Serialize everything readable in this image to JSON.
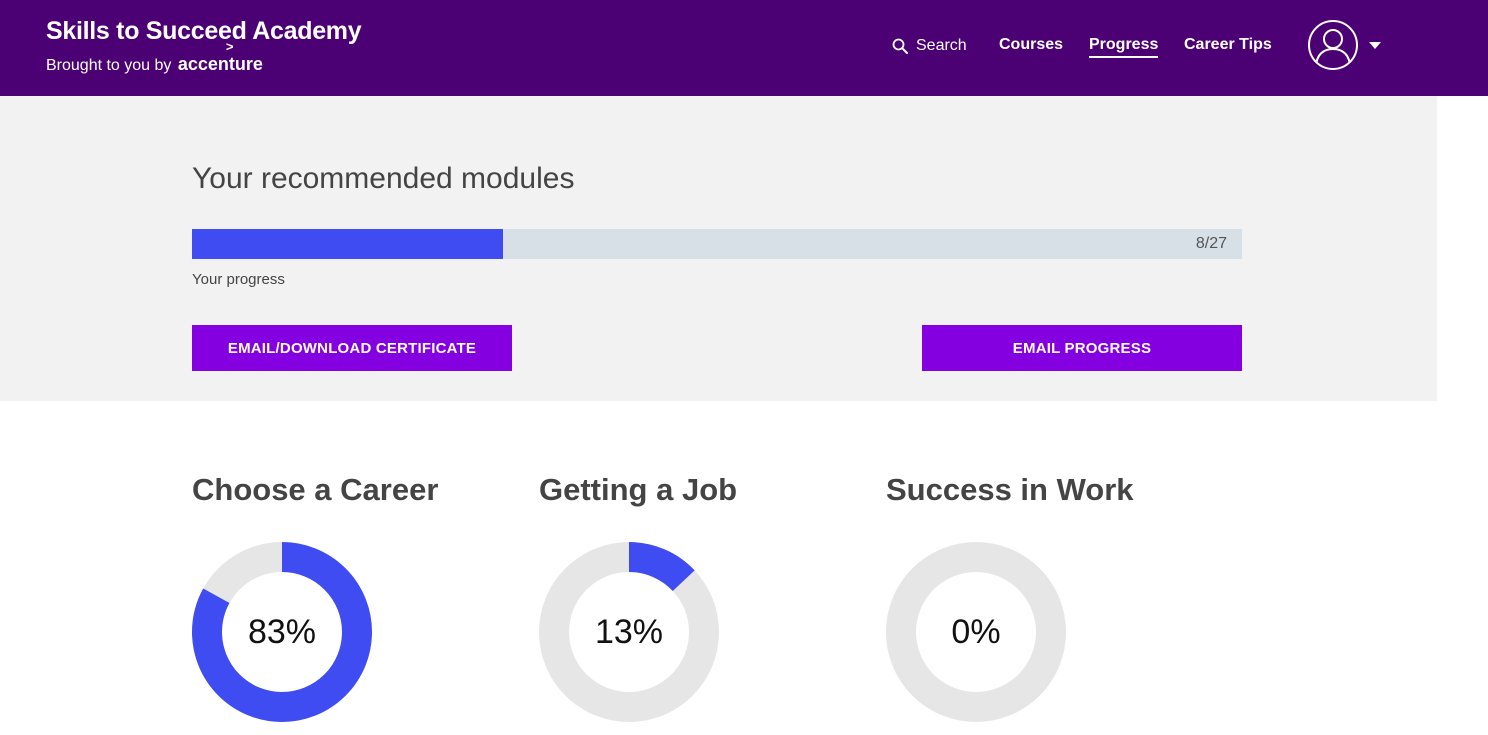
{
  "header": {
    "title": "Skills to Succeed Academy",
    "subtitle": "Brought to you by",
    "brand": "accenture",
    "brand_mark": ">",
    "bg_color": "#4b0073",
    "nav": {
      "search_label": "Search",
      "courses_label": "Courses",
      "progress_label": "Progress",
      "tips_label": "Career Tips"
    },
    "avatar_icon": "user-avatar-icon",
    "caret_icon": "caret-down-icon"
  },
  "recommended": {
    "title": "Your recommended modules",
    "progress_label": "Your progress",
    "completed": 8,
    "total": 27,
    "count_text": "8/27",
    "fill_color": "#3e4cf2",
    "track_color": "#d7e0e7",
    "certificate_button": "EMAIL/DOWNLOAD CERTIFICATE",
    "email_button": "EMAIL PROGRESS",
    "button_color": "#8500e0"
  },
  "categories": [
    {
      "title": "Choose a Career",
      "percent": 83,
      "label": "83%"
    },
    {
      "title": "Getting a Job",
      "percent": 13,
      "label": "13%"
    },
    {
      "title": "Success in Work",
      "percent": 0,
      "label": "0%"
    }
  ],
  "donut_colors": {
    "fill": "#3e4cf2",
    "track": "#e6e6e6"
  }
}
